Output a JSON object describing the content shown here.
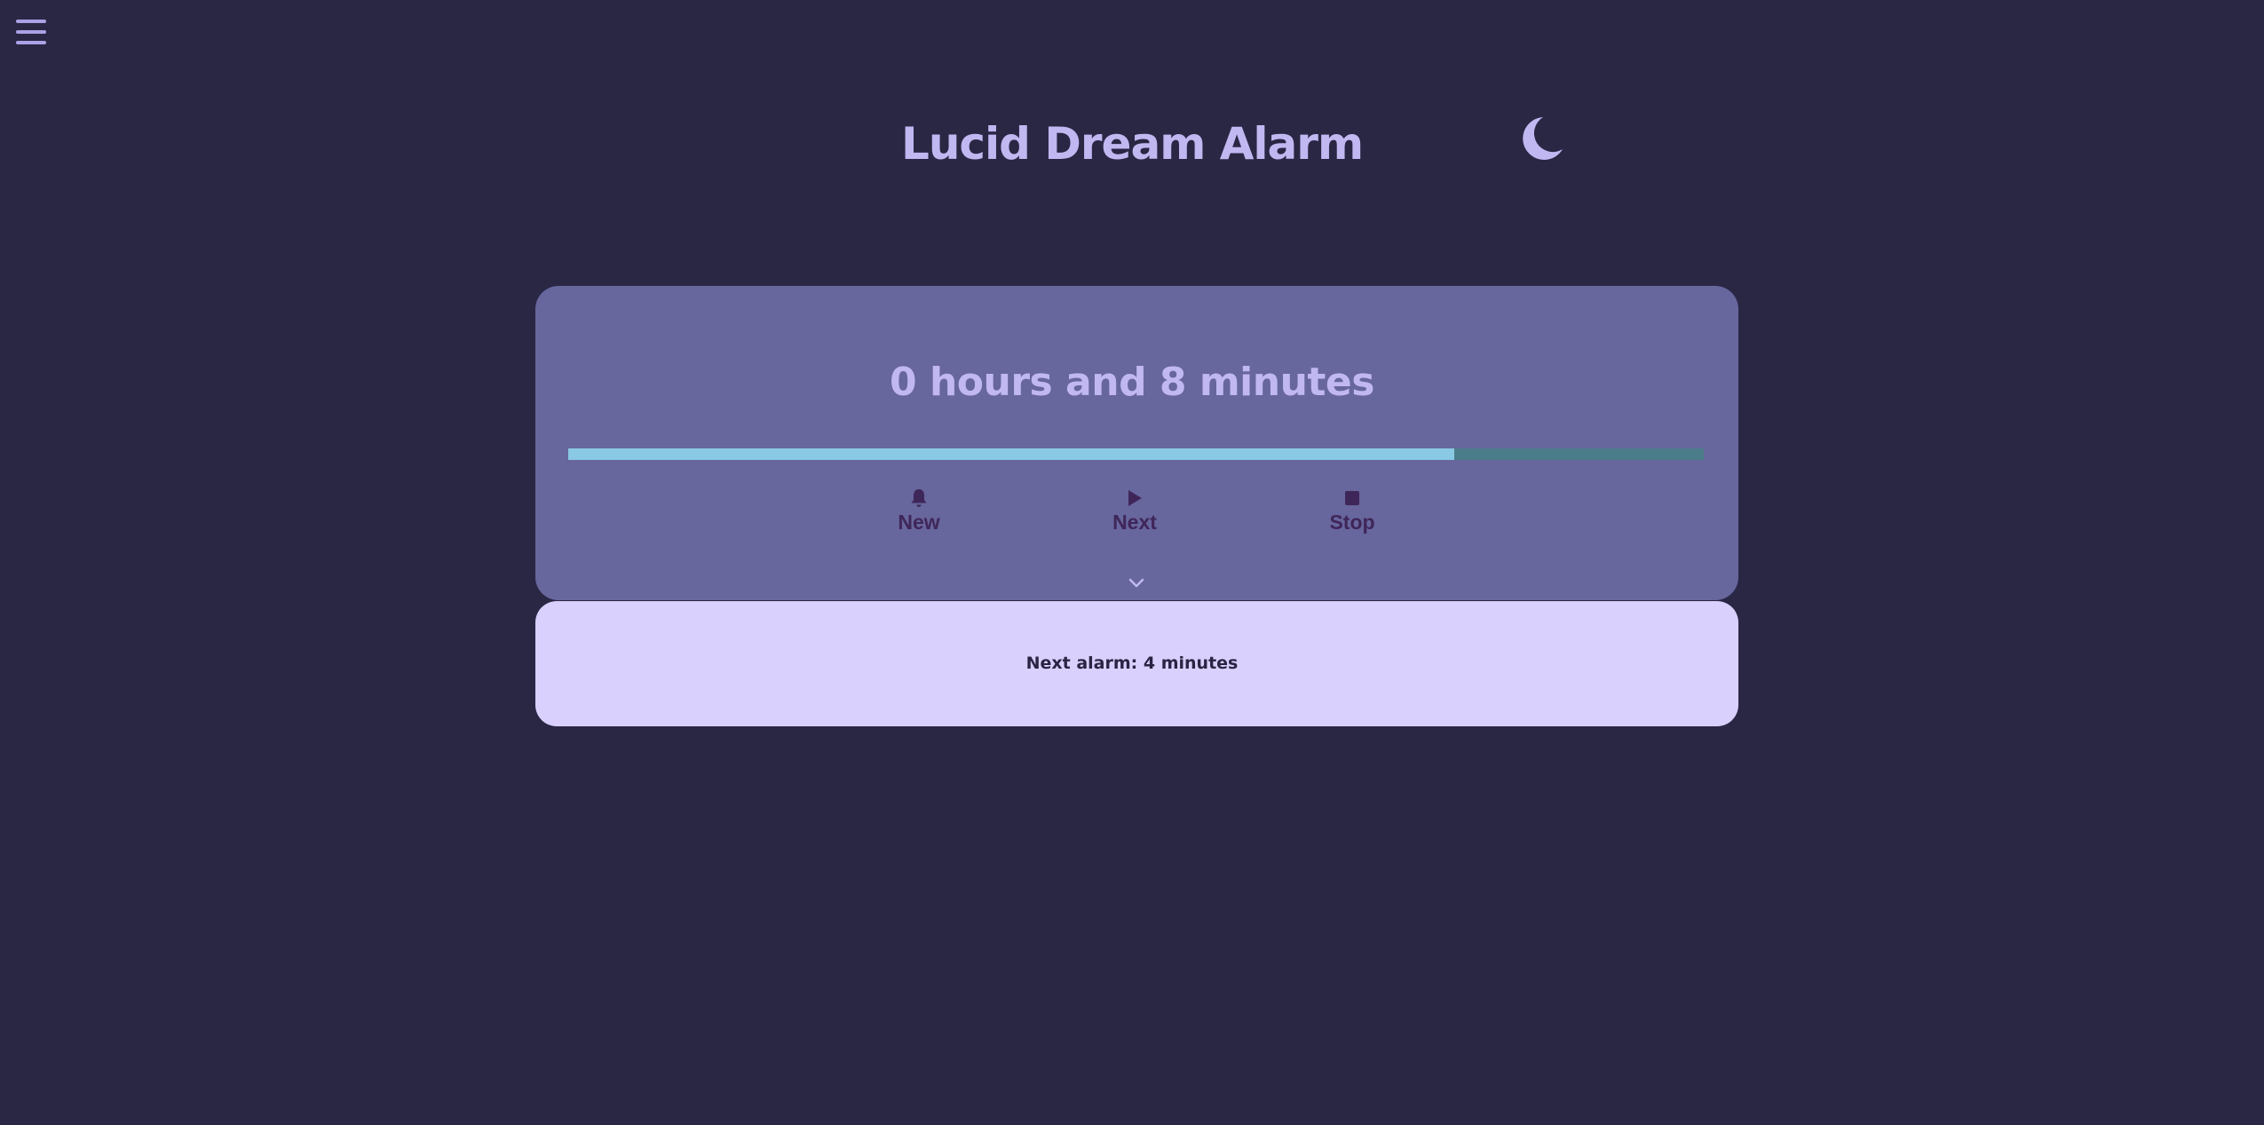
{
  "app": {
    "title": "Lucid Dream Alarm"
  },
  "header": {
    "menu_icon": "hamburger-menu-icon",
    "theme_icon": "crescent-moon-icon"
  },
  "timer": {
    "remaining_text": "0 hours and 8 minutes",
    "progress_percent": 78,
    "expand_icon": "chevron-down-icon"
  },
  "controls": {
    "new": {
      "label": "New",
      "icon": "bell-icon"
    },
    "next": {
      "label": "Next",
      "icon": "play-icon"
    },
    "stop": {
      "label": "Stop",
      "icon": "stop-icon"
    }
  },
  "next_alarm": {
    "text": "Next alarm: 4 minutes"
  },
  "colors": {
    "background": "#2a2745",
    "card": "#67669d",
    "accent_text": "#c1b8f1",
    "progress_fill": "#8ac9e3",
    "progress_track": "#4b7c89",
    "button_text": "#3f2659",
    "next_alarm_card": "#d9d0fd"
  }
}
